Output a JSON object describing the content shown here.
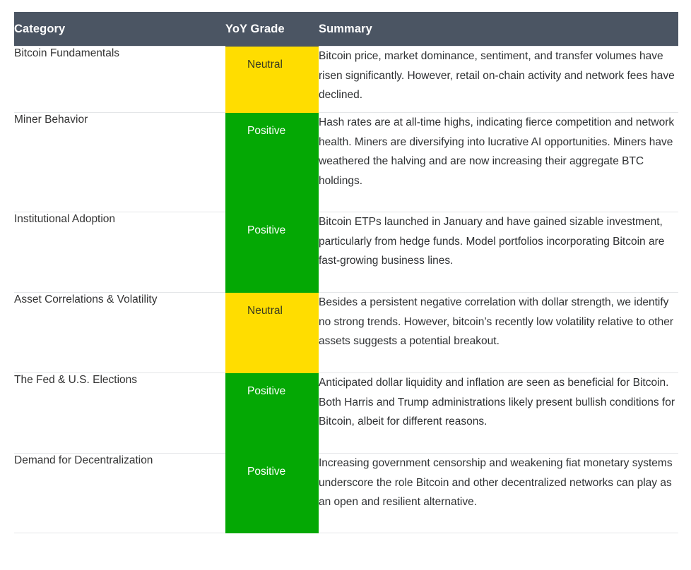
{
  "table": {
    "columns": [
      {
        "key": "category",
        "label": "Category"
      },
      {
        "key": "grade",
        "label": "YoY Grade"
      },
      {
        "key": "summary",
        "label": "Summary"
      }
    ],
    "header_bg": "#4b5563",
    "grade_colors": {
      "Positive": "#04a804",
      "Neutral": "#ffdd00"
    },
    "rows": [
      {
        "category": "Bitcoin Fundamentals",
        "grade": "Neutral",
        "grade_tone": "neutral",
        "summary": "Bitcoin price, market dominance, sentiment, and transfer volumes have risen significantly. However, retail on-chain activity and network fees have declined."
      },
      {
        "category": "Miner Behavior",
        "grade": "Positive",
        "grade_tone": "positive",
        "summary": "Hash rates are at all-time highs, indicating fierce competition and network health. Miners are diversifying into lucrative AI opportunities. Miners have weathered the halving and are now increasing their aggregate BTC holdings."
      },
      {
        "category": "Institutional Adoption",
        "grade": "Positive",
        "grade_tone": "positive",
        "summary": "Bitcoin ETPs launched in January and have gained sizable investment, particularly from hedge funds. Model portfolios incorporating Bitcoin are fast-growing business lines."
      },
      {
        "category": "Asset Correlations & Volatility",
        "grade": "Neutral",
        "grade_tone": "neutral",
        "summary": "Besides a persistent negative correlation with dollar strength, we identify no strong trends. However, bitcoin’s recently low volatility relative to other assets suggests a potential breakout."
      },
      {
        "category": "The Fed & U.S. Elections",
        "grade": "Positive",
        "grade_tone": "positive",
        "summary": "Anticipated dollar liquidity and inflation are seen as beneficial for Bitcoin. Both Harris and Trump administrations likely present bullish conditions for Bitcoin, albeit for different reasons."
      },
      {
        "category": "Demand for Decentralization",
        "grade": "Positive",
        "grade_tone": "positive",
        "summary": "Increasing government censorship and weakening fiat monetary systems underscore the role Bitcoin and other decentralized networks can play as an open and resilient alternative."
      }
    ]
  }
}
